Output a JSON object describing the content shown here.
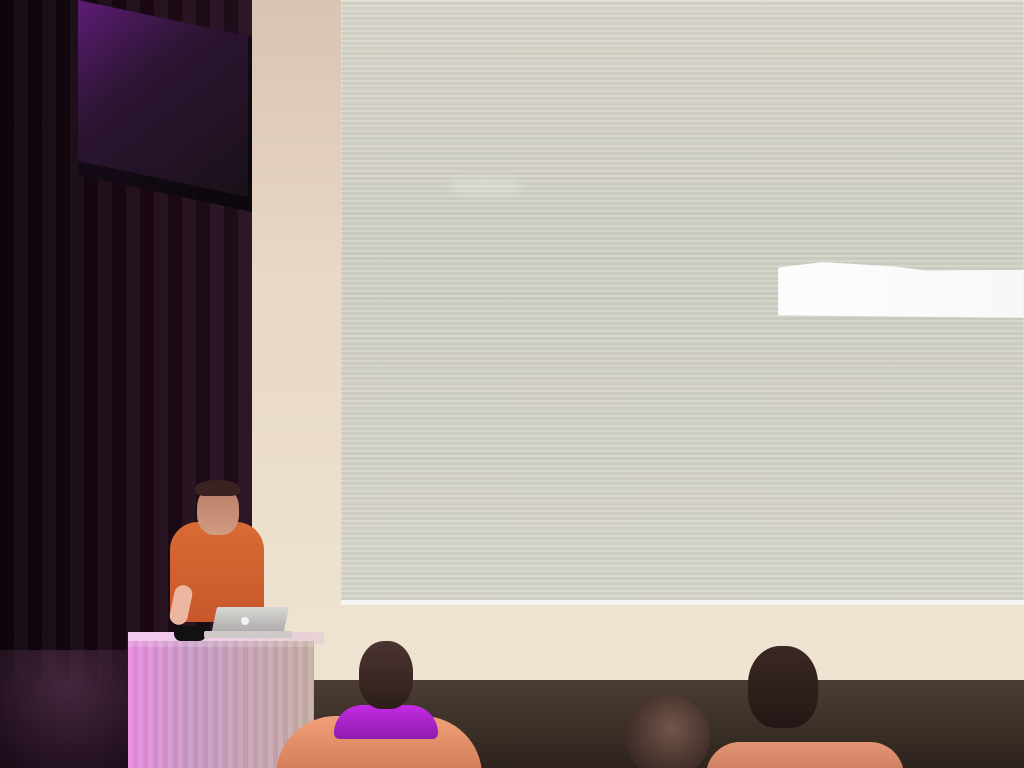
{
  "scene": {
    "type": "presentation-room"
  }
}
